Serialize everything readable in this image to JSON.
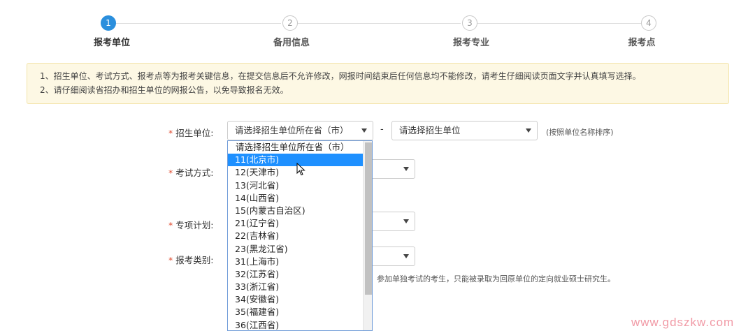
{
  "stepper": {
    "steps": [
      {
        "num": "1",
        "label": "报考单位",
        "active": true
      },
      {
        "num": "2",
        "label": "备用信息",
        "active": false
      },
      {
        "num": "3",
        "label": "报考专业",
        "active": false
      },
      {
        "num": "4",
        "label": "报考点",
        "active": false
      }
    ]
  },
  "notice": {
    "lines": [
      "1、招生单位、考试方式、报考点等为报考关键信息，在提交信息后不允许修改，网报时间结束后任何信息均不能修改，请考生仔细阅读页面文字并认真填写选择。",
      "2、请仔细阅读省招办和招生单位的网报公告，以免导致报名无效。"
    ]
  },
  "form": {
    "star": "*",
    "unit_label": "招生单位:",
    "province_select_value": "请选择招生单位所在省（市）",
    "dash": "-",
    "unit_select_value": "请选择招生单位",
    "unit_hint": "(按照单位名称排序)",
    "exam_label": "考试方式:",
    "special_label": "专项计划:",
    "category_label": "报考类别:",
    "category_hint": "两种。参加单独考试的考生，只能被录取为回原单位的定向就业硕士研究生。"
  },
  "dropdown": {
    "selected_index": 1,
    "options": [
      "请选择招生单位所在省（市）",
      "11(北京市)",
      "12(天津市)",
      "13(河北省)",
      "14(山西省)",
      "15(内蒙古自治区)",
      "21(辽宁省)",
      "22(吉林省)",
      "23(黑龙江省)",
      "31(上海市)",
      "32(江苏省)",
      "33(浙江省)",
      "34(安徽省)",
      "35(福建省)",
      "36(江西省)"
    ]
  },
  "colors": {
    "accent": "#2b8fdd",
    "highlight": "#1e90ff",
    "notice_bg": "#fdf8e4",
    "required": "#e04b2f"
  },
  "watermark": "www.gdszkw.com"
}
